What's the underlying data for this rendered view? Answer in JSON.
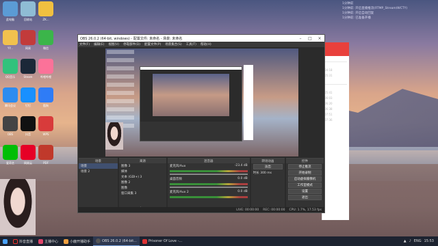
{
  "window": {
    "title": "OBS 26.0.2 (64-bit, windows) - 配置文件: 未命名 - 场景: 未命名",
    "menu": [
      "文件(F)",
      "编辑(E)",
      "视图(V)",
      "停靠部件(D)",
      "配置文件(P)",
      "场景集合(S)",
      "工具(T)",
      "帮助(H)"
    ]
  },
  "notifications": [
    "1分钟前",
    "1分钟前: 开启直播推流(RTMP_Stream/WCTY)",
    "1分钟前: 开启自动回复",
    "1分钟前: 已准备开播"
  ],
  "docks": {
    "scenes": {
      "header": "场景",
      "items": [
        "场景",
        "场景 2"
      ],
      "footer": "+ − ∧ ∨"
    },
    "sources": {
      "header": "来源",
      "items": [
        "图像 3",
        "媒体",
        "文本 (GDI+) 3",
        "图像 2",
        "图像",
        "窗口采集 3"
      ],
      "footer": "+ − ⚙ ∧ ∨"
    },
    "mixer": {
      "header": "混音器",
      "channels": [
        {
          "name": "麦克风/Aux",
          "db": "-23.4 dB"
        },
        {
          "name": "桌面音频",
          "db": "0.0 dB"
        },
        {
          "name": "麦克风/Aux 2",
          "db": "0.0 dB"
        }
      ]
    },
    "transitions": {
      "header": "转场动画",
      "type": "淡出",
      "duration_label": "时长",
      "duration": "300 ms"
    },
    "controls": {
      "header": "控件",
      "buttons": [
        "停止推流",
        "开始录制",
        "启动虚拟摄像机",
        "工作室模式",
        "设置",
        "退出"
      ]
    }
  },
  "status": {
    "live": "LIVE: 00:00:00",
    "rec": "REC: 00:00:00",
    "cpu": "CPU: 1.7%, 17.53 fps"
  },
  "desktop_icons": [
    "此电脑",
    "回收站",
    "ZK...",
    "YY...",
    "网易",
    "微信",
    "QQ音乐",
    "Steam",
    "哔哩哔哩",
    "腾讯会议",
    "钉钉",
    "酷狗",
    "OBS",
    "抖音",
    "WPS",
    "爱奇艺",
    "网易云",
    "PDF"
  ],
  "taskbar": {
    "items": [
      "抖音直播",
      "主播中心",
      "小鹿开播助手",
      "OBS 26.0.2 (64-bit...",
      "Prisoner Of Love -..."
    ],
    "clock": "15:53",
    "lang": "ENG"
  },
  "bgwindow": {
    "dates": [
      "04:18",
      "05:31",
      "05:41",
      "06:03",
      "06:20",
      "06:38",
      "07:51",
      "07:36"
    ]
  }
}
